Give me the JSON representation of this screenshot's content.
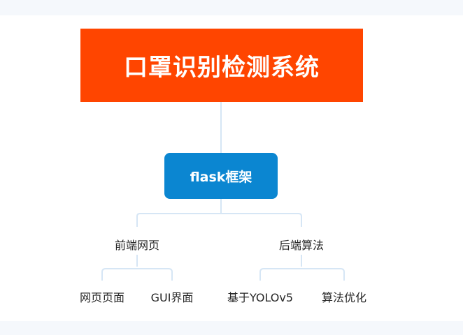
{
  "mindmap": {
    "root": {
      "label": "口罩识别检测系统",
      "color": "#ff4500"
    },
    "main": {
      "label": "flask框架",
      "color": "#0b86d1"
    },
    "branches": [
      {
        "label": "前端网页",
        "children": [
          {
            "label": "网页页面"
          },
          {
            "label": "GUI界面"
          }
        ]
      },
      {
        "label": "后端算法",
        "children": [
          {
            "label": "基于YOLOv5"
          },
          {
            "label": "算法优化"
          }
        ]
      }
    ],
    "connector_color": "#d6e6f5"
  }
}
